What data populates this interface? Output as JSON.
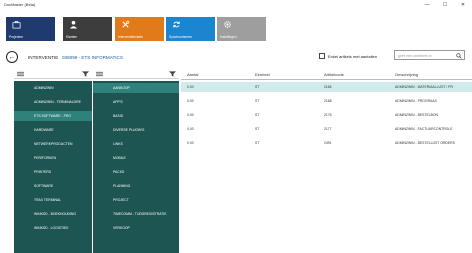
{
  "window": {
    "title": "DocMaster (Beta)",
    "controls": [
      "—",
      "☐",
      "✕"
    ]
  },
  "nav": {
    "tiles": [
      {
        "label": "Projecten",
        "color": "#1e3a6e",
        "icon": "briefcase-icon"
      },
      {
        "label": "Klanten",
        "color": "#3d3d3d",
        "icon": "person-icon"
      },
      {
        "label": "Interventietickets",
        "color": "#e07b1b",
        "icon": "tools-icon"
      },
      {
        "label": "Synchroniseren",
        "color": "#1b85cf",
        "icon": "sync-icon"
      },
      {
        "label": "Instellingen",
        "color": "#9e9e9e",
        "icon": "gear-icon"
      }
    ]
  },
  "header": {
    "breadcrumb_section": "INTERVENTIE",
    "breadcrumb_detail": "036099 - ETS INFORMATICS",
    "checkbox_label": "Enkel artikels met aantallen",
    "search_placeholder": "geef een zoekterm in"
  },
  "left_panel": {
    "items": [
      {
        "label": "ADMINZWIN",
        "selected": false
      },
      {
        "label": "ADMINZWIN - TERMINALDRE",
        "selected": false
      },
      {
        "label": "ETS SOFTWARE - PRO",
        "selected": true
      },
      {
        "label": "HARDWARE",
        "selected": false
      },
      {
        "label": "NETWERKPRODUCTEN",
        "selected": false
      },
      {
        "label": "PERIFORKEN",
        "selected": false
      },
      {
        "label": "PRINTERS",
        "selected": false
      },
      {
        "label": "SOFTWARE",
        "selected": false
      },
      {
        "label": "TRAX TERMINAL",
        "selected": false
      },
      {
        "label": "WINKSD - BOEKHOUDING",
        "selected": false
      },
      {
        "label": "WINKSD - LOGISTIEK",
        "selected": false
      }
    ]
  },
  "mid_panel": {
    "items": [
      {
        "label": "AANKOOP",
        "selected": true
      },
      {
        "label": "APP'S",
        "selected": false
      },
      {
        "label": "BASIS",
        "selected": false
      },
      {
        "label": "DIVERSE PLUGIN'S",
        "selected": false
      },
      {
        "label": "LINKS",
        "selected": false
      },
      {
        "label": "MOBILE",
        "selected": false
      },
      {
        "label": "PACKS",
        "selected": false
      },
      {
        "label": "PLANNING",
        "selected": false
      },
      {
        "label": "PROJECT",
        "selected": false
      },
      {
        "label": "TIMECOMM - TIJDSREGISTRATIE",
        "selected": false
      },
      {
        "label": "VERKOOP",
        "selected": false
      }
    ]
  },
  "grid": {
    "columns": [
      "Aantal",
      "Eenheid",
      "Artikelcode",
      "Omschrijving"
    ],
    "rows": [
      {
        "aantal": "0,00",
        "eenheid": "ST",
        "code": "2166",
        "omschrijving": "ADMINZWIN - MATERIAALLIJST / PR",
        "selected": true
      },
      {
        "aantal": "0,00",
        "eenheid": "ST",
        "code": "2168",
        "omschrijving": "ADMINZWIN - PROGRAAS",
        "selected": false
      },
      {
        "aantal": "0,00",
        "eenheid": "ST",
        "code": "2176",
        "omschrijving": "ADMINZWIN - BESTELBON",
        "selected": false
      },
      {
        "aantal": "0,00",
        "eenheid": "ST",
        "code": "2177",
        "omschrijving": "ADMINZWIN - FACTUURCONTROLE",
        "selected": false
      },
      {
        "aantal": "0,00",
        "eenheid": "ST",
        "code": "2491",
        "omschrijving": "ADMINZWIN - BESTELLIJST ORDERS",
        "selected": false
      }
    ]
  },
  "colors": {
    "panel_bg": "#1d5552",
    "panel_selected": "#2f817b",
    "row_selected": "#cfeceb",
    "breadcrumb_link": "#1a5fa8"
  }
}
